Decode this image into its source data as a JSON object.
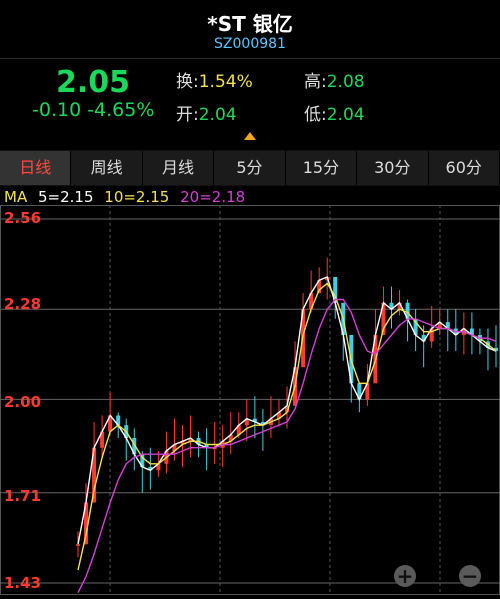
{
  "header": {
    "title": "*ST 银亿",
    "code": "SZ000981"
  },
  "quote": {
    "price": "2.05",
    "change": "-0.10 -4.65%",
    "turnover_label": "换:",
    "turnover_value": "1.54%",
    "high_label": "高:",
    "high_value": "2.08",
    "open_label": "开:",
    "open_value": "2.04",
    "low_label": "低:",
    "low_value": "2.04"
  },
  "tabs": [
    "日线",
    "周线",
    "月线",
    "5分",
    "15分",
    "30分",
    "60分"
  ],
  "active_tab": 0,
  "ma": {
    "label": "MA",
    "ma5": "5=2.15",
    "ma10": "10=2.15",
    "ma20": "20=2.18"
  },
  "colors": {
    "up": "#ff3b30",
    "down": "#1bd75a",
    "ma5": "#ffffff",
    "ma10": "#f3e24a",
    "ma20": "#d43fd4",
    "code": "#5bc7ff"
  },
  "zoom": {
    "plus_icon": "plus-icon",
    "minus_icon": "minus-icon"
  },
  "chart_data": {
    "type": "line",
    "ylim": [
      1.43,
      2.56
    ],
    "y_ticks": [
      "2.56",
      "2.28",
      "2.00",
      "1.71",
      "1.43"
    ],
    "series": [
      {
        "values": [
          1.55,
          1.68,
          1.85,
          1.9,
          1.95,
          1.92,
          1.88,
          1.83,
          1.79,
          1.78,
          1.8,
          1.84,
          1.86,
          1.87,
          1.88,
          1.86,
          1.85,
          1.85,
          1.87,
          1.89,
          1.92,
          1.94,
          1.93,
          1.92,
          1.94,
          1.96,
          1.98,
          2.1,
          2.28,
          2.33,
          2.37,
          2.38,
          2.3,
          2.2,
          2.05,
          2.0,
          2.05,
          2.2,
          2.3,
          2.28,
          2.3,
          2.25,
          2.2,
          2.18,
          2.22,
          2.24,
          2.22,
          2.2,
          2.22,
          2.2,
          2.18,
          2.16,
          2.15
        ]
      },
      {
        "values": [
          1.47,
          1.58,
          1.72,
          1.82,
          1.9,
          1.92,
          1.9,
          1.86,
          1.82,
          1.8,
          1.8,
          1.82,
          1.84,
          1.86,
          1.87,
          1.87,
          1.86,
          1.86,
          1.86,
          1.87,
          1.89,
          1.91,
          1.92,
          1.92,
          1.93,
          1.94,
          1.96,
          2.04,
          2.2,
          2.28,
          2.34,
          2.36,
          2.32,
          2.25,
          2.12,
          2.05,
          2.05,
          2.12,
          2.22,
          2.26,
          2.28,
          2.27,
          2.24,
          2.21,
          2.21,
          2.22,
          2.22,
          2.21,
          2.21,
          2.2,
          2.19,
          2.17,
          2.15
        ]
      },
      {
        "values": [
          1.4,
          1.45,
          1.52,
          1.6,
          1.68,
          1.75,
          1.8,
          1.82,
          1.83,
          1.83,
          1.83,
          1.83,
          1.83,
          1.84,
          1.85,
          1.85,
          1.85,
          1.85,
          1.86,
          1.86,
          1.87,
          1.88,
          1.89,
          1.9,
          1.91,
          1.92,
          1.93,
          1.97,
          2.05,
          2.14,
          2.22,
          2.28,
          2.31,
          2.31,
          2.27,
          2.2,
          2.15,
          2.14,
          2.17,
          2.2,
          2.23,
          2.25,
          2.25,
          2.24,
          2.23,
          2.22,
          2.22,
          2.21,
          2.21,
          2.2,
          2.19,
          2.19,
          2.18
        ]
      }
    ]
  }
}
